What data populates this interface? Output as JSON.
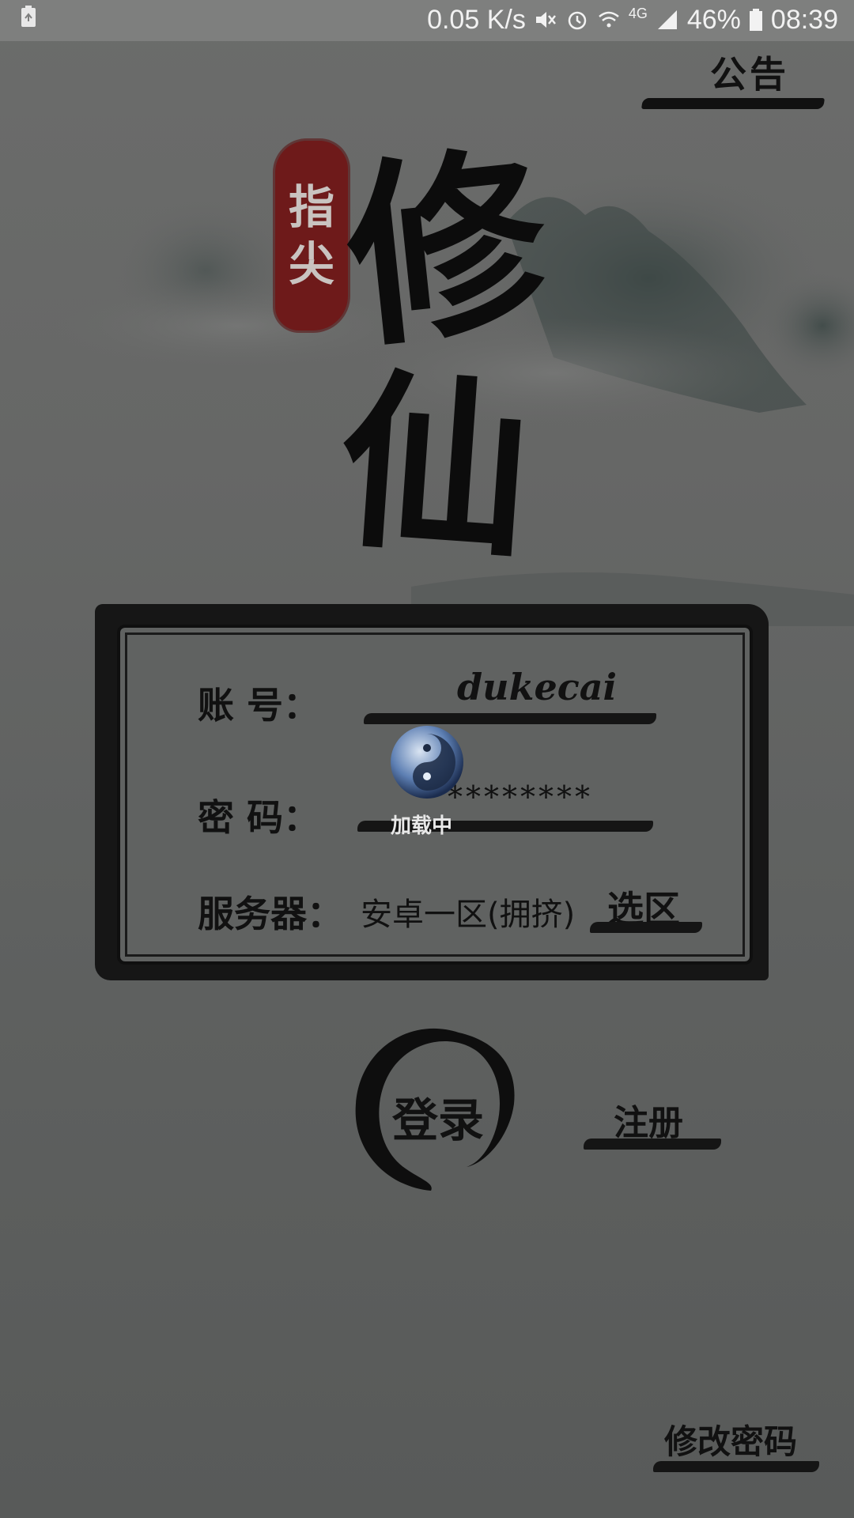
{
  "status_bar": {
    "network_speed": "0.05 K/s",
    "network_type": "4G",
    "battery_percent": "46%",
    "time": "08:39",
    "icons": [
      "recycle-icon",
      "mute-icon",
      "alarm-icon",
      "wifi-icon",
      "signal-icon",
      "battery-icon"
    ]
  },
  "header": {
    "notice_label": "公告"
  },
  "title": {
    "seal_top": "指",
    "seal_bottom": "尖",
    "char_1": "修",
    "char_2": "仙"
  },
  "login_form": {
    "account_label": "账  号：",
    "account_value": "dukecai",
    "password_label": "密  码：",
    "password_value": "********",
    "server_label": "服务器：",
    "server_value": "安卓一区(拥挤)",
    "select_server_label": "选区"
  },
  "loading": {
    "text": "加载中"
  },
  "actions": {
    "login_label": "登录",
    "register_label": "注册",
    "change_password_label": "修改密码"
  },
  "colors": {
    "background": "#5f6160",
    "ink": "#111111",
    "seal_red": "#6e1a1a"
  }
}
